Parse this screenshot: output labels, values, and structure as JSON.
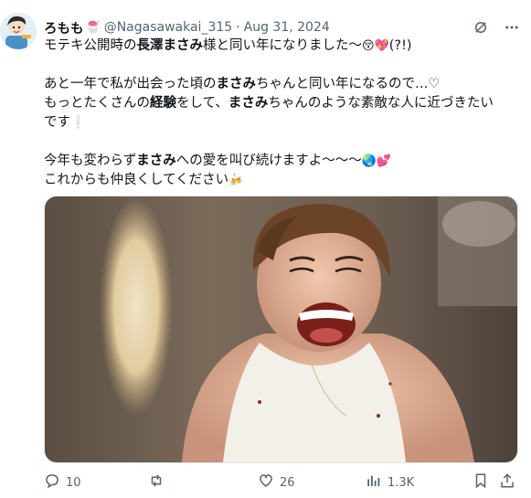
{
  "author": {
    "display_name": "ろもも",
    "name_emoji": "🍧",
    "handle": "@Nagasawakai_315",
    "separator": "·",
    "date": "Aug 31, 2024"
  },
  "post": {
    "line1_a": "モテキ公開時の",
    "line1_b": "長澤まさみ",
    "line1_c": "様と同い年になりました〜",
    "line1_emoji": "😚💖",
    "line1_d": "(?!)",
    "line2_a": "あと一年で私が出会った頃の",
    "line2_b": "まさみ",
    "line2_c": "ちゃんと同い年になるので…♡",
    "line3_a": "もっとたくさんの",
    "line3_b": "経験",
    "line3_c": "をして、",
    "line3_d": "まさみ",
    "line3_e": "ちゃんのような素敵な人に近づきたい",
    "line4_a": "です",
    "line4_emoji": "❕",
    "line5_a": "今年も変わらず",
    "line5_b": "まさみ",
    "line5_c": "への愛を叫び続けますよ〜〜〜",
    "line5_emoji": "🌏💕",
    "line6_a": "これからも仲良くしてください",
    "line6_emoji": "🍻"
  },
  "actions": {
    "replies": "10",
    "reposts": "",
    "likes": "26",
    "views": "1.3K"
  },
  "colors": {
    "text": "#0f1419",
    "muted": "#536471"
  },
  "icons": [
    "avatar",
    "grok-icon",
    "more-icon",
    "reply-icon",
    "repost-icon",
    "like-icon",
    "views-icon",
    "bookmark-icon",
    "share-icon"
  ]
}
